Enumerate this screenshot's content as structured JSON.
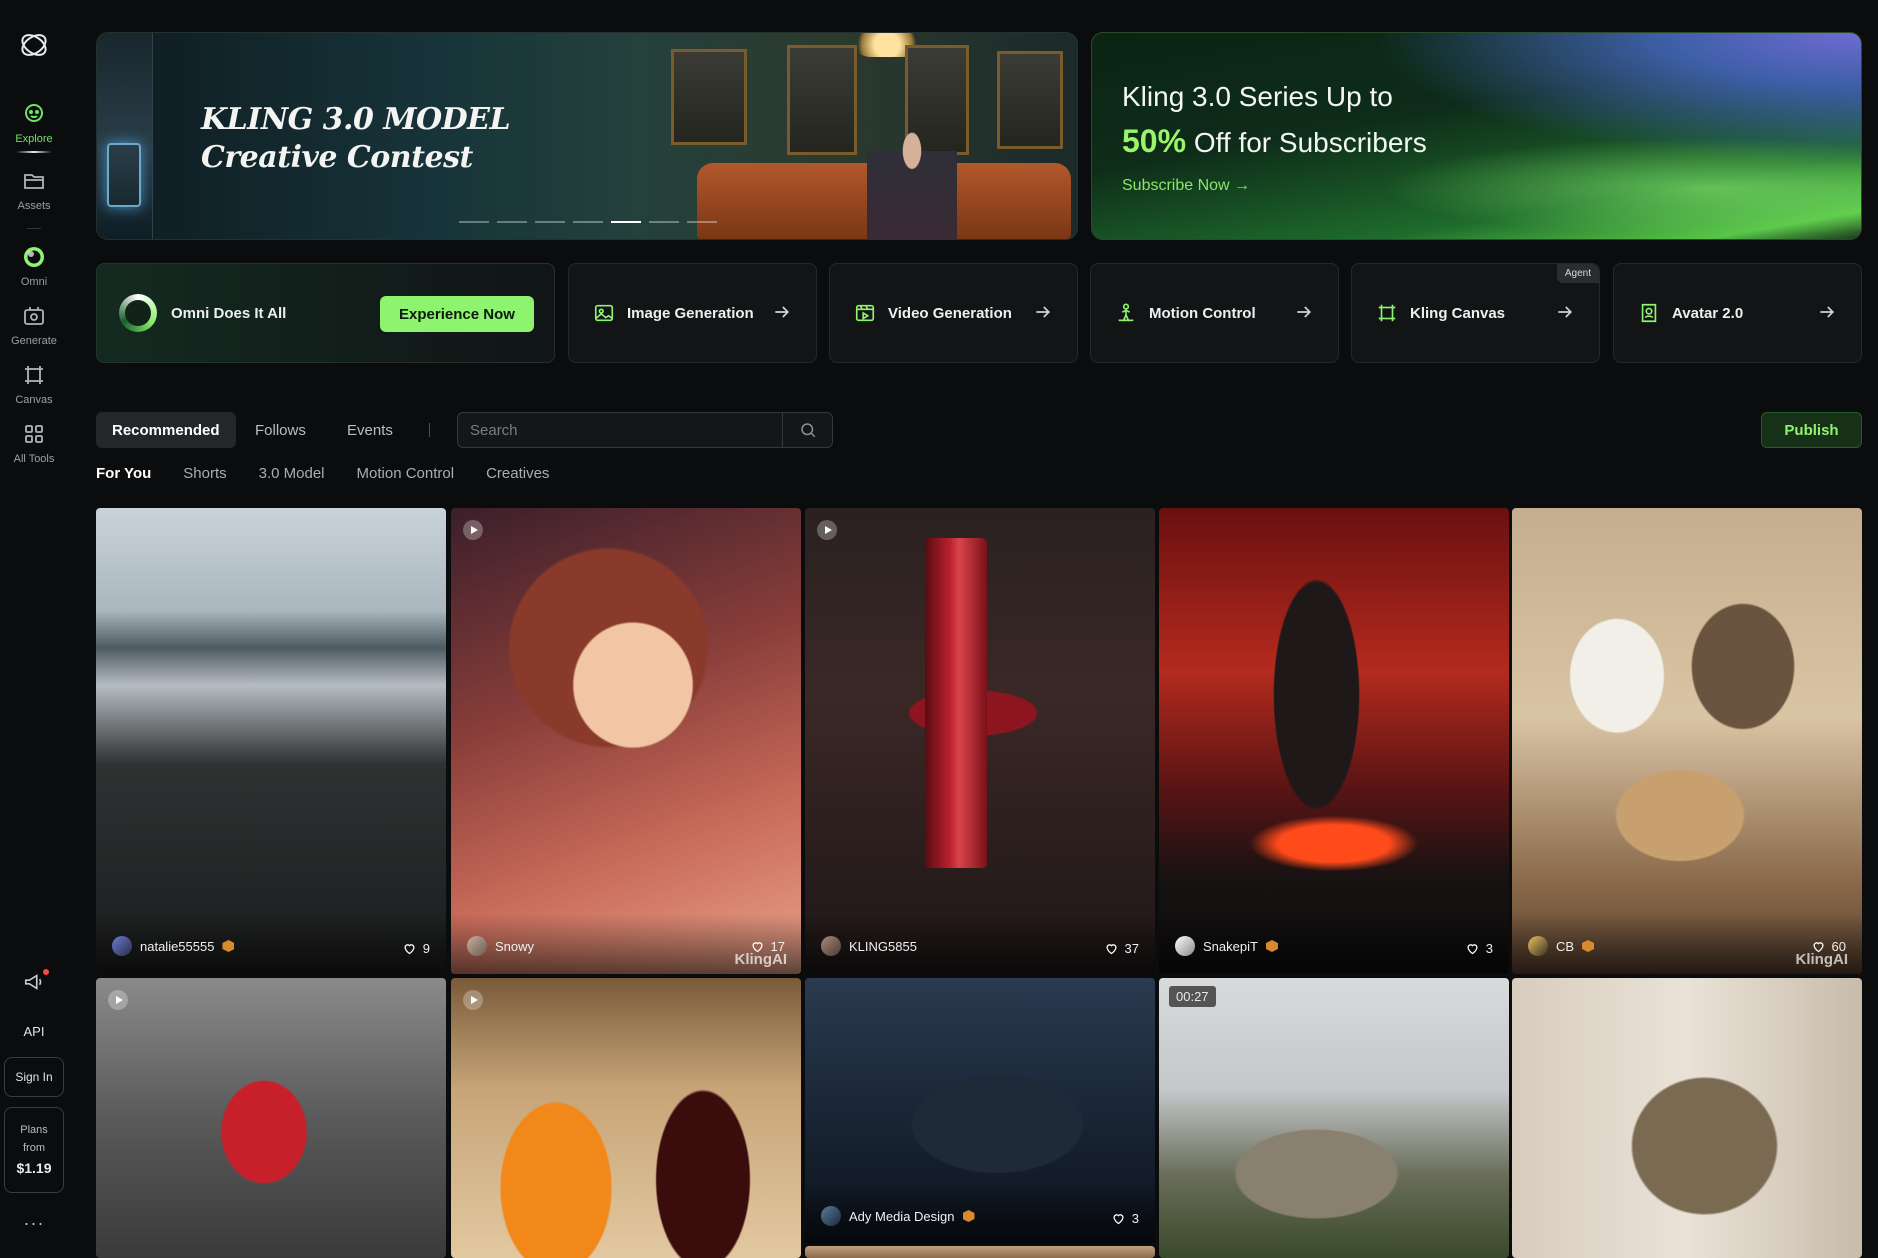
{
  "sidebar": {
    "items": [
      {
        "label": "Explore",
        "icon": "explore-icon",
        "active": true
      },
      {
        "label": "Assets",
        "icon": "folder-icon"
      },
      {
        "label": "Omni",
        "icon": "omni-icon"
      },
      {
        "label": "Generate",
        "icon": "generate-icon"
      },
      {
        "label": "Canvas",
        "icon": "canvas-icon"
      },
      {
        "label": "All Tools",
        "icon": "grid-icon"
      }
    ],
    "api_label": "API",
    "signin_label": "Sign In",
    "plans": {
      "line1": "Plans",
      "line2": "from",
      "price": "$1.19"
    },
    "more_label": "···"
  },
  "banner": {
    "title_line1": "KLING 3.0 MODEL",
    "title_line2": "Creative Contest",
    "carousel_count": 7,
    "carousel_active": 5
  },
  "promo": {
    "line1": "Kling 3.0 Series Up to",
    "percent": "50%",
    "line2_rest": "Off for Subscribers",
    "link": "Subscribe Now →"
  },
  "features": {
    "omni_label": "Omni Does It All",
    "omni_button": "Experience Now",
    "cards": [
      {
        "label": "Image Generation",
        "icon": "image-icon"
      },
      {
        "label": "Video Generation",
        "icon": "video-icon"
      },
      {
        "label": "Motion Control",
        "icon": "motion-icon"
      },
      {
        "label": "Kling Canvas",
        "icon": "canvas-icon",
        "badge": "Agent"
      },
      {
        "label": "Avatar 2.0",
        "icon": "avatar-icon"
      }
    ]
  },
  "tabs": [
    "Recommended",
    "Follows",
    "Events"
  ],
  "search": {
    "placeholder": "Search"
  },
  "publish_label": "Publish",
  "subtabs": [
    "For You",
    "Shorts",
    "3.0 Model",
    "Motion Control",
    "Creatives"
  ],
  "feed": [
    {
      "author": "natalie55555",
      "likes": "9",
      "badge": true
    },
    {
      "author": "Snowy",
      "likes": "17",
      "watermark": "KlingAI"
    },
    {
      "author": "KLING5855",
      "likes": "37"
    },
    {
      "author": "SnakepiT",
      "likes": "3",
      "badge": true
    },
    {
      "author": "CB",
      "likes": "60",
      "badge": true,
      "watermark": "KlingAI"
    },
    {
      "author": "Ady Media Design",
      "likes": "3",
      "badge": true
    },
    {
      "duration": "00:27"
    }
  ],
  "colors": {
    "accent": "#8ef36e",
    "background": "#0b0c0d",
    "card": "#121416"
  }
}
